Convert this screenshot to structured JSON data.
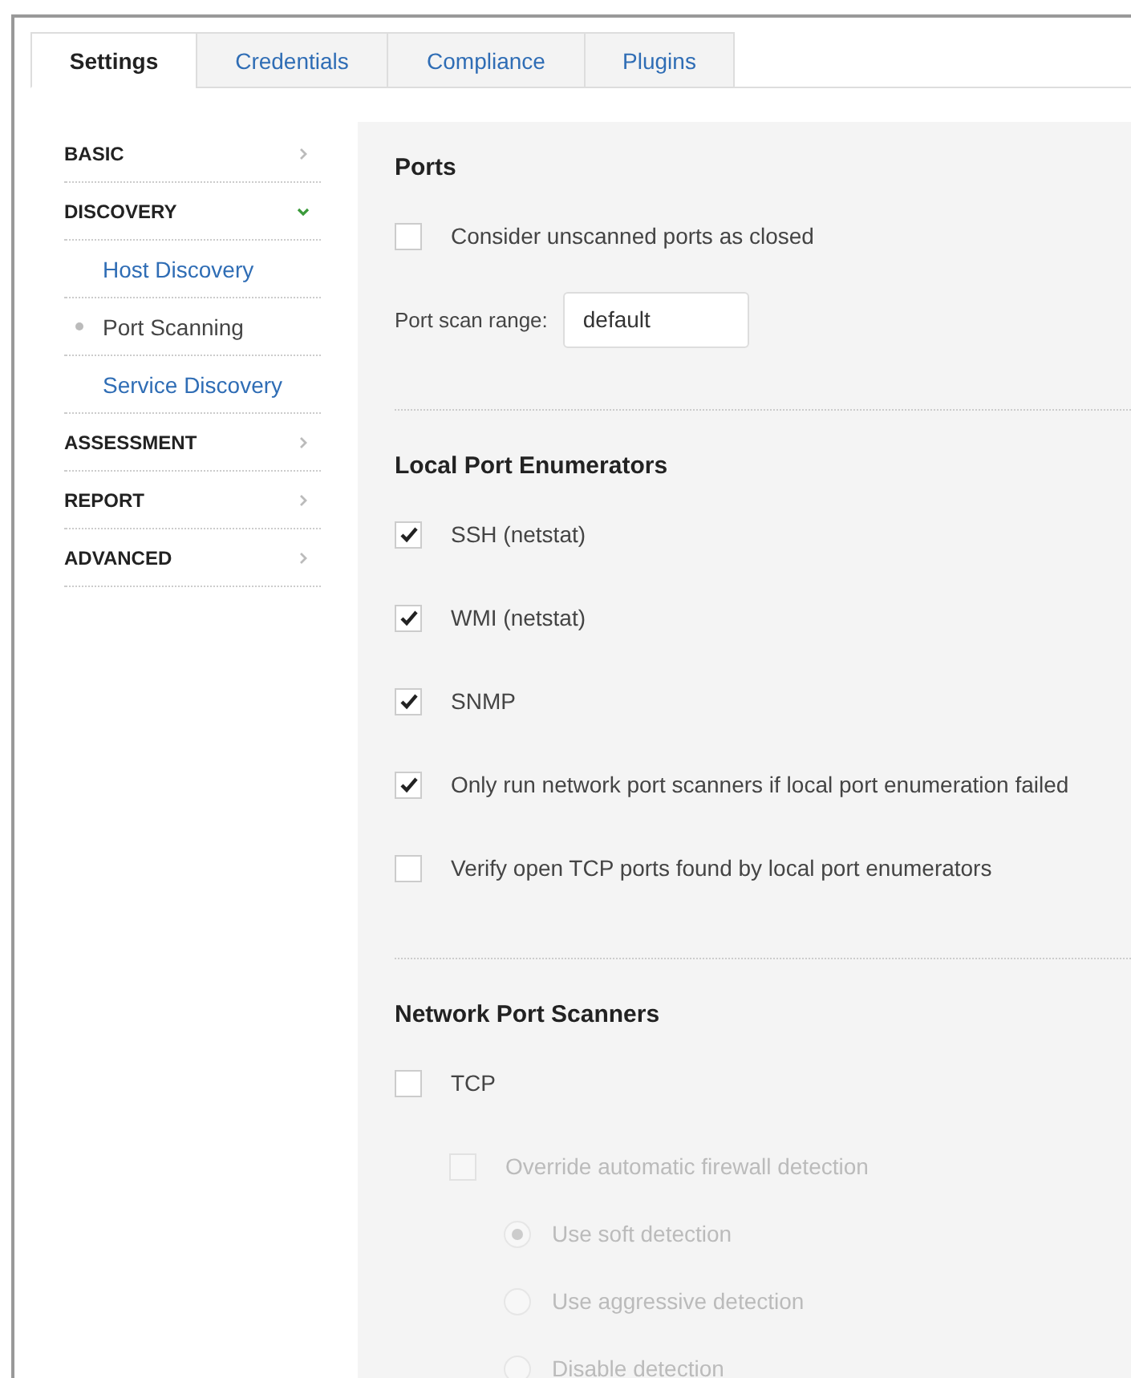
{
  "tabs": [
    {
      "label": "Settings",
      "selected": true
    },
    {
      "label": "Credentials",
      "selected": false
    },
    {
      "label": "Compliance",
      "selected": false
    },
    {
      "label": "Plugins",
      "selected": false
    }
  ],
  "sidebar": {
    "items": [
      {
        "label": "BASIC",
        "expanded": false
      },
      {
        "label": "DISCOVERY",
        "expanded": true,
        "children": [
          {
            "label": "Host Discovery",
            "selected": false
          },
          {
            "label": "Port Scanning",
            "selected": true
          },
          {
            "label": "Service Discovery",
            "selected": false
          }
        ]
      },
      {
        "label": "ASSESSMENT",
        "expanded": false
      },
      {
        "label": "REPORT",
        "expanded": false
      },
      {
        "label": "ADVANCED",
        "expanded": false
      }
    ]
  },
  "sections": [
    {
      "title": "Ports",
      "items": [
        {
          "kind": "checkbox",
          "label": "Consider unscanned ports as closed",
          "checked": false,
          "disabled": false
        },
        {
          "kind": "field",
          "label": "Port scan range:",
          "value": "default"
        }
      ]
    },
    {
      "title": "Local Port Enumerators",
      "items": [
        {
          "kind": "checkbox",
          "label": "SSH (netstat)",
          "checked": true,
          "disabled": false
        },
        {
          "kind": "checkbox",
          "label": "WMI (netstat)",
          "checked": true,
          "disabled": false
        },
        {
          "kind": "checkbox",
          "label": "SNMP",
          "checked": true,
          "disabled": false
        },
        {
          "kind": "checkbox",
          "label": "Only run network port scanners if local port enumeration failed",
          "checked": true,
          "disabled": false
        },
        {
          "kind": "checkbox",
          "label": "Verify open TCP ports found by local port enumerators",
          "checked": false,
          "disabled": false
        }
      ]
    },
    {
      "title": "Network Port Scanners",
      "items": [
        {
          "kind": "checkbox",
          "label": "TCP",
          "checked": false,
          "disabled": false,
          "children": [
            {
              "kind": "checkbox",
              "label": "Override automatic firewall detection",
              "checked": false,
              "disabled": true,
              "children": [
                {
                  "kind": "radio",
                  "label": "Use soft detection",
                  "selected": true,
                  "disabled": true
                },
                {
                  "kind": "radio",
                  "label": "Use aggressive detection",
                  "selected": false,
                  "disabled": true
                },
                {
                  "kind": "radio",
                  "label": "Disable detection",
                  "selected": false,
                  "disabled": true
                }
              ]
            }
          ]
        }
      ]
    }
  ]
}
